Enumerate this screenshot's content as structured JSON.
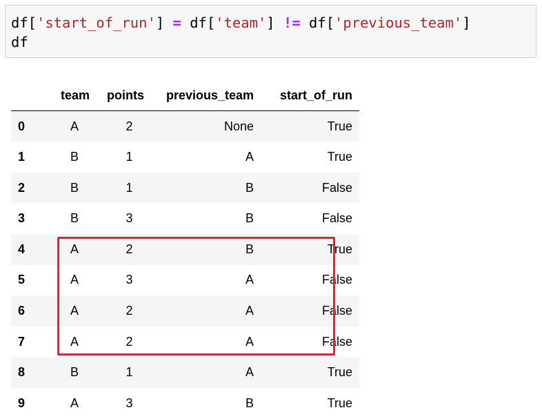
{
  "code_cell": {
    "line1": [
      {
        "text": "df[",
        "kind": "plain"
      },
      {
        "text": "'start_of_run'",
        "kind": "str"
      },
      {
        "text": "] ",
        "kind": "plain"
      },
      {
        "text": "=",
        "kind": "op"
      },
      {
        "text": " df[",
        "kind": "plain"
      },
      {
        "text": "'team'",
        "kind": "str"
      },
      {
        "text": "] ",
        "kind": "plain"
      },
      {
        "text": "!=",
        "kind": "op"
      },
      {
        "text": " df[",
        "kind": "plain"
      },
      {
        "text": "'previous_team'",
        "kind": "str"
      },
      {
        "text": "]",
        "kind": "plain"
      }
    ],
    "line2": "df"
  },
  "table": {
    "columns": [
      "",
      "team",
      "points",
      "previous_team",
      "start_of_run"
    ],
    "rows": [
      {
        "index": "0",
        "team": "A",
        "points": "2",
        "previous_team": "None",
        "start_of_run": "True"
      },
      {
        "index": "1",
        "team": "B",
        "points": "1",
        "previous_team": "A",
        "start_of_run": "True"
      },
      {
        "index": "2",
        "team": "B",
        "points": "1",
        "previous_team": "B",
        "start_of_run": "False"
      },
      {
        "index": "3",
        "team": "B",
        "points": "3",
        "previous_team": "B",
        "start_of_run": "False"
      },
      {
        "index": "4",
        "team": "A",
        "points": "2",
        "previous_team": "B",
        "start_of_run": "True"
      },
      {
        "index": "5",
        "team": "A",
        "points": "3",
        "previous_team": "A",
        "start_of_run": "False"
      },
      {
        "index": "6",
        "team": "A",
        "points": "2",
        "previous_team": "A",
        "start_of_run": "False"
      },
      {
        "index": "7",
        "team": "A",
        "points": "2",
        "previous_team": "A",
        "start_of_run": "False"
      },
      {
        "index": "8",
        "team": "B",
        "points": "1",
        "previous_team": "A",
        "start_of_run": "True"
      },
      {
        "index": "9",
        "team": "A",
        "points": "3",
        "previous_team": "B",
        "start_of_run": "True"
      }
    ]
  },
  "highlight": {
    "rows": [
      "4",
      "7"
    ],
    "color": "#e0243a"
  },
  "colors": {
    "string": "#ba2121",
    "operator": "#aa22ff",
    "cell_background": "#f7f7f7",
    "stripe": "#f5f5f5"
  }
}
